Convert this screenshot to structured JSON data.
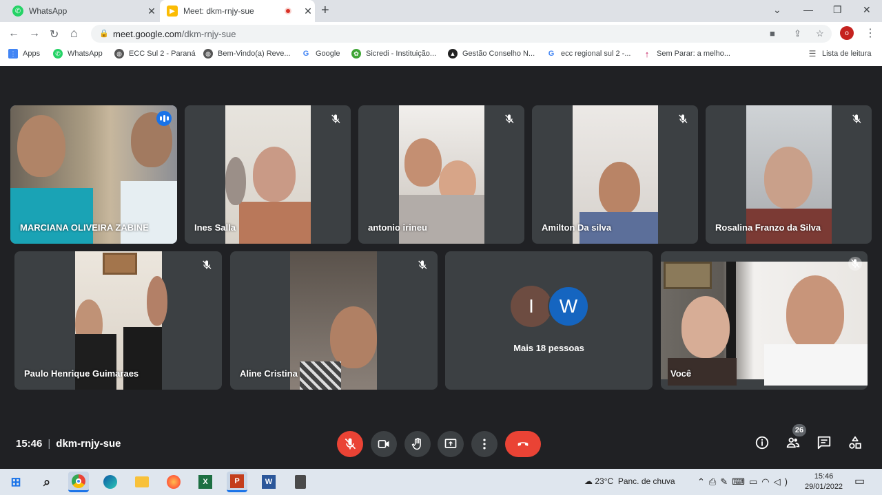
{
  "browser": {
    "tabs": [
      {
        "title": "WhatsApp",
        "favicon": "whatsapp-icon"
      },
      {
        "title": "Meet: dkm-rnjy-sue",
        "favicon": "meet-icon"
      }
    ],
    "url_host": "meet.google.com",
    "url_path": "/dkm-rnjy-sue",
    "profile_initial": "o",
    "bookmarks": [
      "Apps",
      "WhatsApp",
      "ECC Sul 2 - Paraná",
      "Bem-Vindo(a) Reve...",
      "Google",
      "Sicredi - Instituição...",
      "Gestão Conselho N...",
      "ecc regional sul 2 -...",
      "Sem Parar: a melho..."
    ],
    "reading_list": "Lista de leitura"
  },
  "meet": {
    "participants": [
      {
        "name": "MARCIANA OLIVEIRA ZABINE",
        "speaking": true
      },
      {
        "name": "Ines Salla",
        "muted": true
      },
      {
        "name": "antonio irineu",
        "muted": true
      },
      {
        "name": "Amilton Da silva",
        "muted": true
      },
      {
        "name": "Rosalina Franzo da Silva",
        "muted": true
      },
      {
        "name": "Paulo Henrique Guimaraes",
        "muted": true
      },
      {
        "name": "Aline Cristina",
        "muted": true
      },
      {
        "name": "Você",
        "muted": true
      }
    ],
    "more": {
      "label": "Mais 18 pessoas",
      "initials": [
        "I",
        "W"
      ],
      "colors": [
        "#6d4c41",
        "#1565c0"
      ]
    },
    "time": "15:46",
    "meeting_code": "dkm-rnjy-sue",
    "participant_count": "26"
  },
  "taskbar": {
    "weather": "23°C",
    "weather_desc": "Panc. de chuva",
    "time": "15:46",
    "date": "29/01/2022"
  }
}
